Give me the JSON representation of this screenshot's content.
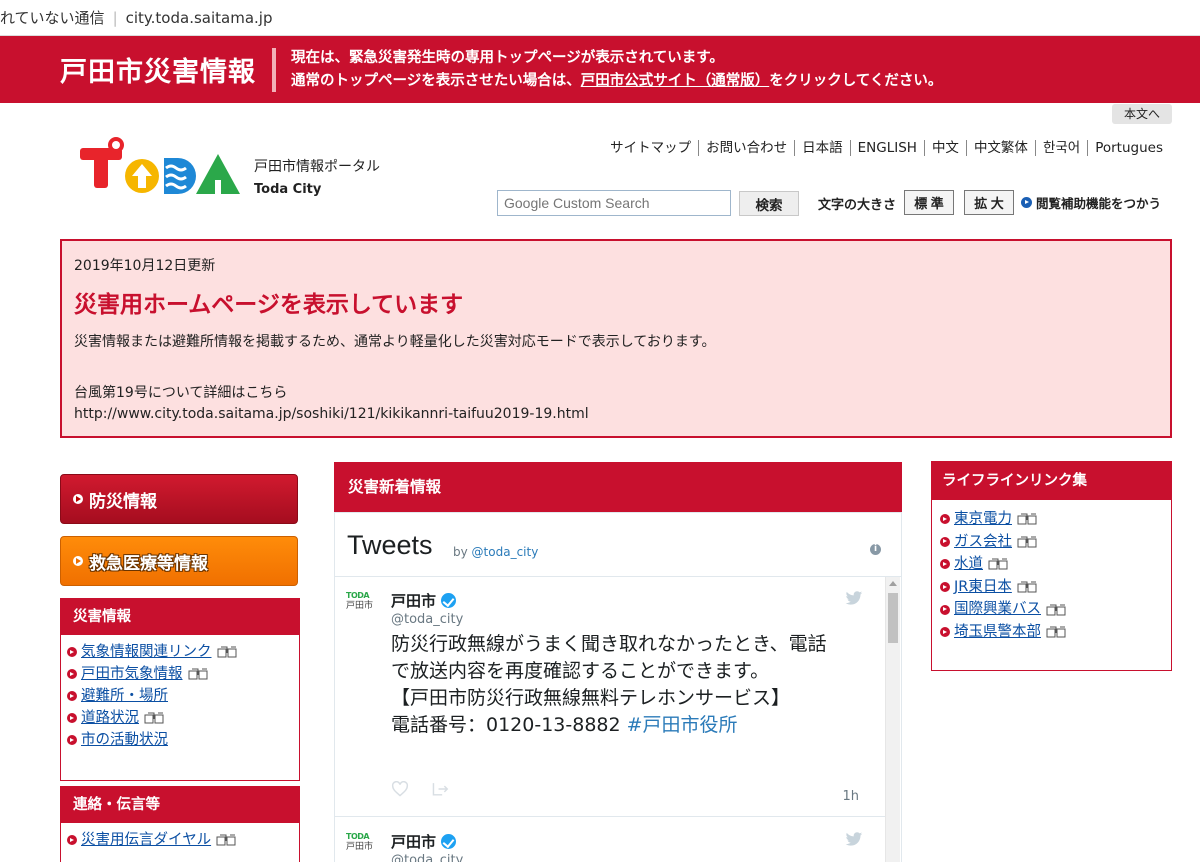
{
  "browser": {
    "security": "れていない通信",
    "url": "city.toda.saitama.jp"
  },
  "banner": {
    "title": "戸田市災害情報",
    "notice_line1": "現在は、緊急災害発生時の専用トップページが表示されています。",
    "notice_line2_pre": "通常のトップページを表示させたい場合は、",
    "notice_link": "戸田市公式サイト（通常版）",
    "notice_line2_post": "をクリックしてください。"
  },
  "skip_link": "本文へ",
  "logo": {
    "portal": "戸田市情報ポータル",
    "city": "Toda City"
  },
  "util_nav": [
    "サイトマップ",
    "お問い合わせ",
    "日本語",
    "ENGLISH",
    "中文",
    "中文繁体",
    "한국어",
    "Portugues"
  ],
  "search": {
    "placeholder": "Google Custom Search",
    "button": "検索"
  },
  "font_size": {
    "label": "文字の大きさ",
    "standard": "標 準",
    "large": "拡 大"
  },
  "assist": "閲覧補助機能をつかう",
  "alert": {
    "updated": "2019年10月12日更新",
    "headline": "災害用ホームページを表示しています",
    "description": "災害情報または避難所情報を掲載するため、通常より軽量化した災害対応モードで表示しております。",
    "typhoon": "台風第19号について詳細はこちら",
    "url": "http://www.city.toda.saitama.jp/soshiki/121/kikikannri-taifuu2019-19.html"
  },
  "left": {
    "btn_bousai": "防災情報",
    "btn_kyukyu": "救急医療等情報",
    "saigai_header": "災害情報",
    "saigai_items": [
      {
        "label": "気象情報関連リンク",
        "ext": true
      },
      {
        "label": "戸田市気象情報",
        "ext": true
      },
      {
        "label": "避難所・場所",
        "ext": false
      },
      {
        "label": "道路状況",
        "ext": true
      },
      {
        "label": "市の活動状況",
        "ext": false
      }
    ],
    "renraku_header": "連絡・伝言等",
    "renraku_items": [
      {
        "label": "災害用伝言ダイヤル",
        "ext": true
      }
    ]
  },
  "center": {
    "header": "災害新着情報",
    "timeline_title": "Tweets",
    "timeline_by": "by",
    "timeline_handle": "@toda_city",
    "tweets": [
      {
        "name": "戸田市",
        "handle": "@toda_city",
        "avatar_label": "戸田市",
        "avatar_logo": "TODA",
        "text_lines": [
          "防災行政無線がうまく聞き取れなかったとき、電話",
          "で放送内容を再度確認することができます。",
          "【戸田市防災行政無線無料テレホンサービス】"
        ],
        "text_last": "電話番号：0120-13-8882 ",
        "hashtag": "#戸田市役所",
        "time": "1h"
      },
      {
        "name": "戸田市",
        "handle": "@toda_city",
        "avatar_label": "戸田市",
        "avatar_logo": "TODA"
      }
    ]
  },
  "right": {
    "header": "ライフラインリンク集",
    "items": [
      "東京電力",
      "ガス会社",
      "水道",
      "JR東日本",
      "国際興業バス",
      "埼玉県警本部"
    ]
  },
  "colors": {
    "brand_red": "#c8102e",
    "alert_bg": "#fde0e0",
    "orange": "#f07000",
    "link": "#0b4fa3",
    "twitter_blue": "#1da1f2"
  }
}
